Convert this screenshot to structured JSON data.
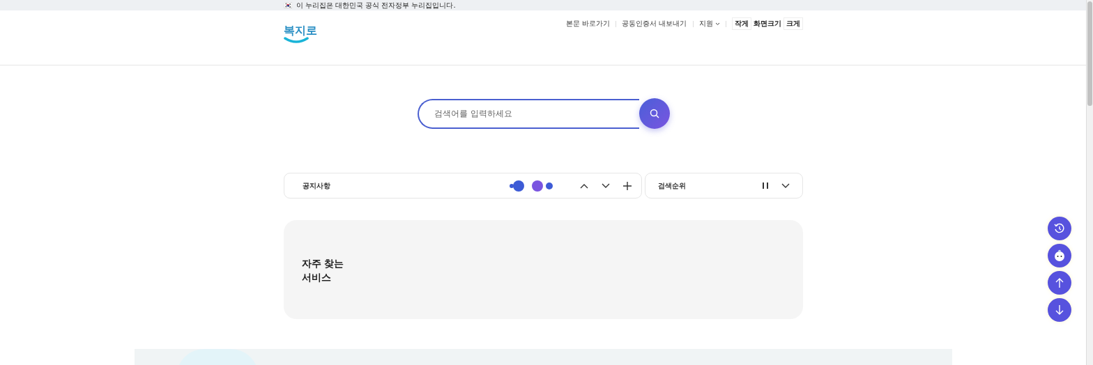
{
  "gov_banner": {
    "flag": "🇰🇷",
    "text": "이 누리집은 대한민국 공식 전자정부 누리집입니다."
  },
  "header": {
    "logo": "복지로",
    "utility_links": [
      {
        "label": "본문 바로가기",
        "kind": "link"
      },
      {
        "label": "공동인증서 내보내기",
        "kind": "link"
      },
      {
        "label": "지원",
        "kind": "dropdown"
      }
    ],
    "font_size": {
      "smaller": "작게",
      "label": "화면크기",
      "larger": "크게"
    }
  },
  "search": {
    "placeholder": "검색어를 입력하세요"
  },
  "notice": {
    "title": "공지사항"
  },
  "ranking": {
    "title": "검색순위"
  },
  "frequent_services": {
    "title": "자주 찾는\n서비스"
  },
  "floating_buttons": [
    {
      "kind": "history"
    },
    {
      "kind": "chatbot"
    },
    {
      "kind": "up"
    },
    {
      "kind": "down"
    }
  ]
}
